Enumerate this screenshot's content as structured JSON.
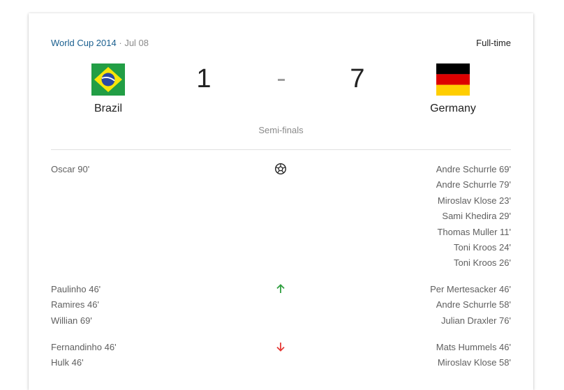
{
  "header": {
    "competition": "World Cup 2014",
    "separator": "·",
    "date": "Jul 08",
    "status": "Full-time"
  },
  "home": {
    "name": "Brazil",
    "score": "1",
    "flag_icon": "brazil-flag-icon",
    "colors": {
      "green": "#229e45",
      "yellow": "#f8e509",
      "blue": "#2b49a3"
    }
  },
  "away": {
    "name": "Germany",
    "score": "7",
    "flag_icon": "germany-flag-icon",
    "colors": {
      "black": "#000000",
      "red": "#dd0000",
      "gold": "#ffce00"
    }
  },
  "score_separator_color": "#9e9e9e",
  "stage": "Semi-finals",
  "events": {
    "goals": {
      "icon": "soccer-ball-icon",
      "home": [
        "Oscar 90'"
      ],
      "away": [
        "Andre Schurrle 69'",
        "Andre Schurrle 79'",
        "Miroslav Klose 23'",
        "Sami Khedira 29'",
        "Thomas Muller 11'",
        "Toni Kroos 24'",
        "Toni Kroos 26'"
      ]
    },
    "subs_in": {
      "icon": "arrow-up-icon",
      "color": "#2e9e3e",
      "home": [
        "Paulinho 46'",
        "Ramires 46'",
        "Willian 69'"
      ],
      "away": [
        "Per Mertesacker 46'",
        "Andre Schurrle 58'",
        "Julian Draxler 76'"
      ]
    },
    "subs_out": {
      "icon": "arrow-down-icon",
      "color": "#e53935",
      "home": [
        "Fernandinho 46'",
        "Hulk 46'"
      ],
      "away": [
        "Mats Hummels 46'",
        "Miroslav Klose 58'"
      ]
    }
  }
}
